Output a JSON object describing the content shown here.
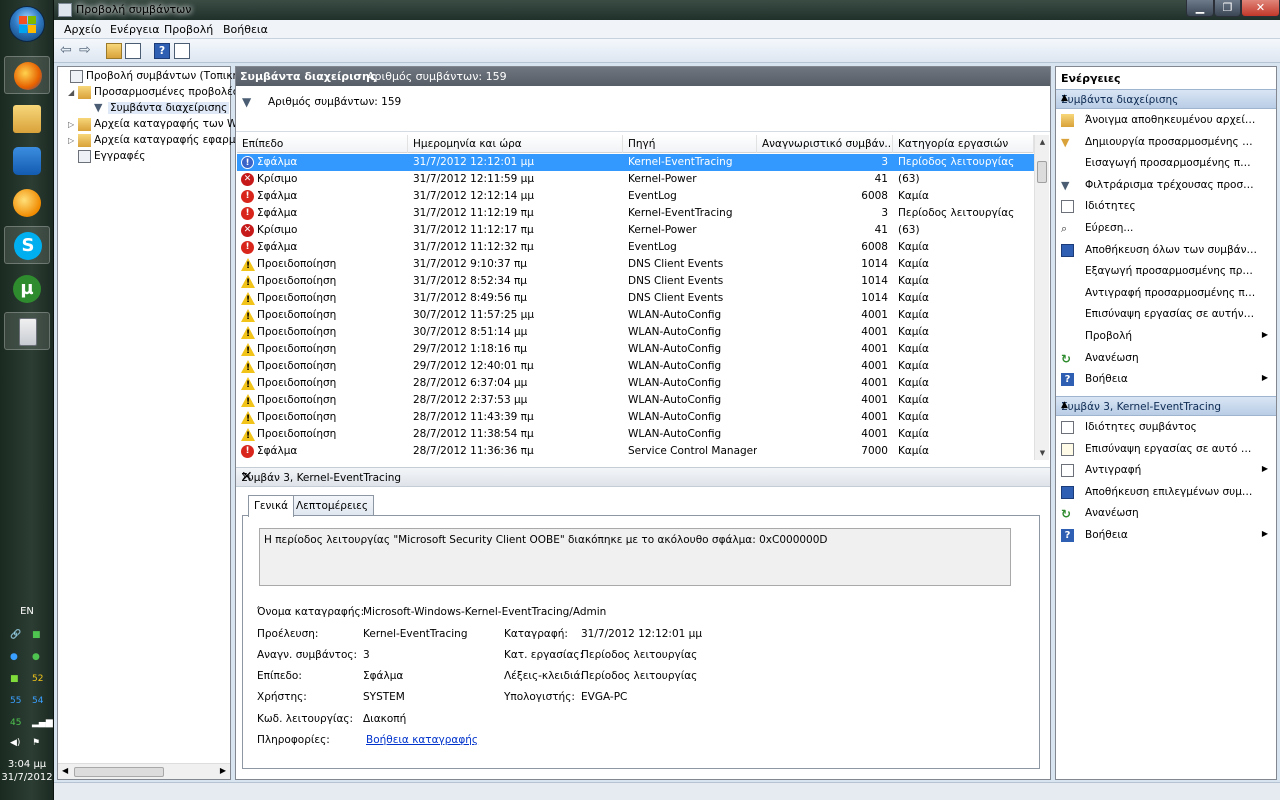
{
  "window": {
    "title": "Προβολή συμβάντων"
  },
  "menu": [
    "Αρχείο",
    "Ενέργεια",
    "Προβολή",
    "Βοήθεια"
  ],
  "tree": [
    {
      "label": "Προβολή συμβάντων (Τοπική)",
      "toggle": ""
    },
    {
      "label": "Προσαρμοσμένες προβολές",
      "toggle": "◢"
    },
    {
      "label": "Συμβάντα διαχείρισης",
      "toggle": ""
    },
    {
      "label": "Αρχεία καταγραφής των Wi",
      "toggle": "▷"
    },
    {
      "label": "Αρχεία καταγραφής εφαρμ",
      "toggle": "▷"
    },
    {
      "label": "Εγγραφές",
      "toggle": ""
    }
  ],
  "center": {
    "header_title": "Συμβάντα διαχείρισης",
    "header_count": "Αριθμός συμβάντων: 159",
    "filter_text": "Αριθμός συμβάντων: 159",
    "columns": [
      "Επίπεδο",
      "Ημερομηνία και ώρα",
      "Πηγή",
      "Αναγνωριστικό συμβάν...",
      "Κατηγορία εργασιών"
    ],
    "rows": [
      {
        "kind": "selinfo",
        "level": "Σφάλμα",
        "date": "31/7/2012 12:12:01 μμ",
        "source": "Kernel-EventTracing",
        "id": "3",
        "cat": "Περίοδος λειτουργίας"
      },
      {
        "kind": "crit",
        "level": "Κρίσιμο",
        "date": "31/7/2012 12:11:59 μμ",
        "source": "Kernel-Power",
        "id": "41",
        "cat": "(63)"
      },
      {
        "kind": "err",
        "level": "Σφάλμα",
        "date": "31/7/2012 12:12:14 μμ",
        "source": "EventLog",
        "id": "6008",
        "cat": "Καμία"
      },
      {
        "kind": "err",
        "level": "Σφάλμα",
        "date": "31/7/2012 11:12:19 πμ",
        "source": "Kernel-EventTracing",
        "id": "3",
        "cat": "Περίοδος λειτουργίας"
      },
      {
        "kind": "crit",
        "level": "Κρίσιμο",
        "date": "31/7/2012 11:12:17 πμ",
        "source": "Kernel-Power",
        "id": "41",
        "cat": "(63)"
      },
      {
        "kind": "err",
        "level": "Σφάλμα",
        "date": "31/7/2012 11:12:32 πμ",
        "source": "EventLog",
        "id": "6008",
        "cat": "Καμία"
      },
      {
        "kind": "warn",
        "level": "Προειδοποίηση",
        "date": "31/7/2012 9:10:37 πμ",
        "source": "DNS Client Events",
        "id": "1014",
        "cat": "Καμία"
      },
      {
        "kind": "warn",
        "level": "Προειδοποίηση",
        "date": "31/7/2012 8:52:34 πμ",
        "source": "DNS Client Events",
        "id": "1014",
        "cat": "Καμία"
      },
      {
        "kind": "warn",
        "level": "Προειδοποίηση",
        "date": "31/7/2012 8:49:56 πμ",
        "source": "DNS Client Events",
        "id": "1014",
        "cat": "Καμία"
      },
      {
        "kind": "warn",
        "level": "Προειδοποίηση",
        "date": "30/7/2012 11:57:25 μμ",
        "source": "WLAN-AutoConfig",
        "id": "4001",
        "cat": "Καμία"
      },
      {
        "kind": "warn",
        "level": "Προειδοποίηση",
        "date": "30/7/2012 8:51:14 μμ",
        "source": "WLAN-AutoConfig",
        "id": "4001",
        "cat": "Καμία"
      },
      {
        "kind": "warn",
        "level": "Προειδοποίηση",
        "date": "29/7/2012 1:18:16 πμ",
        "source": "WLAN-AutoConfig",
        "id": "4001",
        "cat": "Καμία"
      },
      {
        "kind": "warn",
        "level": "Προειδοποίηση",
        "date": "29/7/2012 12:40:01 πμ",
        "source": "WLAN-AutoConfig",
        "id": "4001",
        "cat": "Καμία"
      },
      {
        "kind": "warn",
        "level": "Προειδοποίηση",
        "date": "28/7/2012 6:37:04 μμ",
        "source": "WLAN-AutoConfig",
        "id": "4001",
        "cat": "Καμία"
      },
      {
        "kind": "warn",
        "level": "Προειδοποίηση",
        "date": "28/7/2012 2:37:53 μμ",
        "source": "WLAN-AutoConfig",
        "id": "4001",
        "cat": "Καμία"
      },
      {
        "kind": "warn",
        "level": "Προειδοποίηση",
        "date": "28/7/2012 11:43:39 πμ",
        "source": "WLAN-AutoConfig",
        "id": "4001",
        "cat": "Καμία"
      },
      {
        "kind": "warn",
        "level": "Προειδοποίηση",
        "date": "28/7/2012 11:38:54 πμ",
        "source": "WLAN-AutoConfig",
        "id": "4001",
        "cat": "Καμία"
      },
      {
        "kind": "err",
        "level": "Σφάλμα",
        "date": "28/7/2012 11:36:36 πμ",
        "source": "Service Control Manager",
        "id": "7000",
        "cat": "Καμία"
      }
    ]
  },
  "detail": {
    "title": "Συμβάν 3, Kernel-EventTracing",
    "tab_general": "Γενικά",
    "tab_details": "Λεπτομέρειες",
    "message": "Η περίοδος λειτουργίας \"Microsoft Security Client OOBE\" διακόπηκε με το ακόλουθο σφάλμα: 0xC000000D",
    "log_name_label": "Όνομα καταγραφής:",
    "log_name": "Microsoft-Windows-Kernel-EventTracing/Admin",
    "source_label": "Προέλευση:",
    "source": "Kernel-EventTracing",
    "logged_label": "Καταγραφή:",
    "logged": "31/7/2012 12:12:01 μμ",
    "event_id_label": "Αναγν. συμβάντος:",
    "event_id": "3",
    "task_label": "Κατ. εργασίας:",
    "task": "Περίοδος λειτουργίας",
    "level_label": "Επίπεδο:",
    "level": "Σφάλμα",
    "keywords_label": "Λέξεις-κλειδιά:",
    "keywords": "Περίοδος λειτουργίας",
    "user_label": "Χρήστης:",
    "user": "SYSTEM",
    "computer_label": "Υπολογιστής:",
    "computer": "EVGA-PC",
    "opcode_label": "Κωδ. λειτουργίας:",
    "opcode": "Διακοπή",
    "info_label": "Πληροφορίες:",
    "info_link": "Βοήθεια καταγραφής"
  },
  "actions": {
    "title": "Ενέργειες",
    "section1": "Συμβάντα διαχείρισης",
    "items1": [
      {
        "label": "Άνοιγμα αποθηκευμένου αρχείου κ...",
        "icon": "open-saved-log-icon",
        "sub": ""
      },
      {
        "label": "Δημιουργία προσαρμοσμένης προ...",
        "icon": "create-custom-view-icon",
        "sub": ""
      },
      {
        "label": "Εισαγωγή προσαρμοσμένης προβ...",
        "icon": "",
        "sub": ""
      },
      {
        "label": "Φιλτράρισμα τρέχουσας προσαρμ...",
        "icon": "filter-icon",
        "sub": ""
      },
      {
        "label": "Ιδιότητες",
        "icon": "properties-icon",
        "sub": ""
      },
      {
        "label": "Εύρεση...",
        "icon": "find-icon",
        "sub": ""
      },
      {
        "label": "Αποθήκευση όλων των συμβάντ...",
        "icon": "save-icon",
        "sub": ""
      },
      {
        "label": "Εξαγωγή προσαρμοσμένης προβο...",
        "icon": "",
        "sub": ""
      },
      {
        "label": "Αντιγραφή προσαρμοσμένης προ...",
        "icon": "",
        "sub": ""
      },
      {
        "label": "Επισύναψη εργασίας σε αυτήν την ...",
        "icon": "",
        "sub": ""
      },
      {
        "label": "Προβολή",
        "icon": "",
        "sub": "▶"
      },
      {
        "label": "Ανανέωση",
        "icon": "refresh-icon",
        "sub": ""
      },
      {
        "label": "Βοήθεια",
        "icon": "help-icon",
        "sub": "▶"
      }
    ],
    "section2": "Συμβάν 3, Kernel-EventTracing",
    "items2": [
      {
        "label": "Ιδιότητες συμβάντος",
        "icon": "event-properties-icon",
        "sub": ""
      },
      {
        "label": "Επισύναψη εργασίας σε αυτό το σ...",
        "icon": "attach-task-icon",
        "sub": ""
      },
      {
        "label": "Αντιγραφή",
        "icon": "copy-icon",
        "sub": "▶"
      },
      {
        "label": "Αποθήκευση επιλεγμένων συμβάν...",
        "icon": "save-icon",
        "sub": ""
      },
      {
        "label": "Ανανέωση",
        "icon": "refresh-icon",
        "sub": ""
      },
      {
        "label": "Βοήθεια",
        "icon": "help-icon",
        "sub": "▶"
      }
    ]
  },
  "taskbar": {
    "lang": "EN",
    "clock_time": "3:04 μμ",
    "clock_date": "31/7/2012",
    "tray1": "52",
    "tray2a": "55",
    "tray2b": "54",
    "tray3": "45"
  },
  "colors": {
    "selection": "#3399ff",
    "error": "#d9261c",
    "warning": "#f2c318",
    "header": "#5f666f"
  }
}
